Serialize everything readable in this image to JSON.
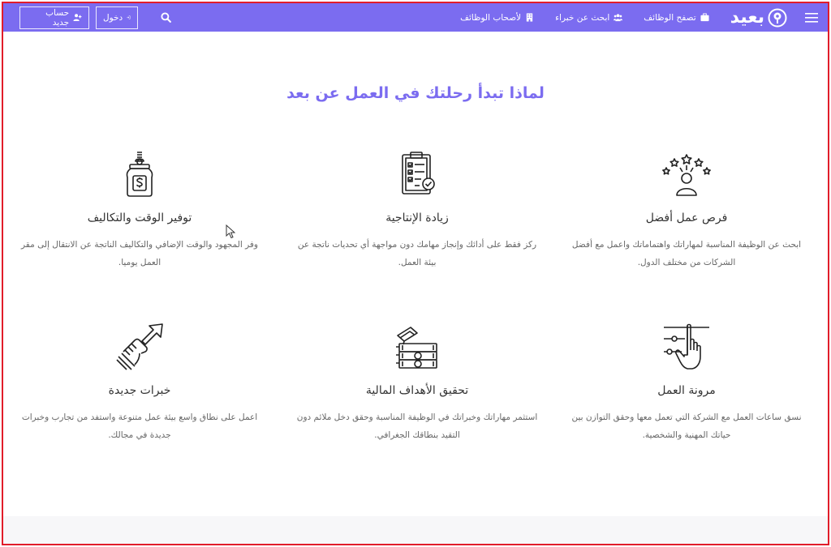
{
  "nav": {
    "logo_text": "بعيد",
    "links": [
      {
        "label": "تصفح الوظائف",
        "icon": "briefcase-icon"
      },
      {
        "label": "ابحث عن خبراء",
        "icon": "users-icon"
      },
      {
        "label": "لأصحاب الوظائف",
        "icon": "building-icon"
      }
    ],
    "signup_label": "حساب جديد",
    "login_label": "دخول"
  },
  "section": {
    "title": "لماذا تبدأ رحلتك في العمل عن بعد"
  },
  "features": [
    {
      "title": "فرص عمل أفضل",
      "desc": "ابحث عن الوظيفة المناسبة لمهاراتك واهتماماتك واعمل مع أفضل الشركات من مختلف الدول.",
      "icon": "person-stars-icon"
    },
    {
      "title": "زيادة الإنتاجية",
      "desc": "ركز فقط على أدائك وإنجاز مهامك دون مواجهة أي تحديات ناتجة عن بيئة العمل.",
      "icon": "clipboard-check-icon"
    },
    {
      "title": "توفير الوقت والتكاليف",
      "desc": "وفر المجهود والوقت الإضافي والتكاليف الناتجة عن الانتقال إلى مقر العمل يوميا.",
      "icon": "money-jar-icon"
    },
    {
      "title": "مرونة العمل",
      "desc": "نسق ساعات العمل مع الشركة التي تعمل معها وحقق التوازن بين حياتك المهنية والشخصية.",
      "icon": "hand-sliders-icon"
    },
    {
      "title": "تحقيق الأهداف المالية",
      "desc": "استثمر مهاراتك وخبراتك في الوظيفة المناسبة وحقق دخل ملائم دون التقيد بنطاقك الجغرافي.",
      "icon": "cash-stack-icon"
    },
    {
      "title": "خبرات جديدة",
      "desc": "اعمل على نطاق واسع بيئة عمل متنوعة واستفد من تجارب وخبرات جديدة في مجالك.",
      "icon": "hand-arrow-icon"
    }
  ],
  "colors": {
    "primary": "#7b6cf0",
    "frame": "#e11d2a",
    "icon_stroke": "#222222"
  }
}
